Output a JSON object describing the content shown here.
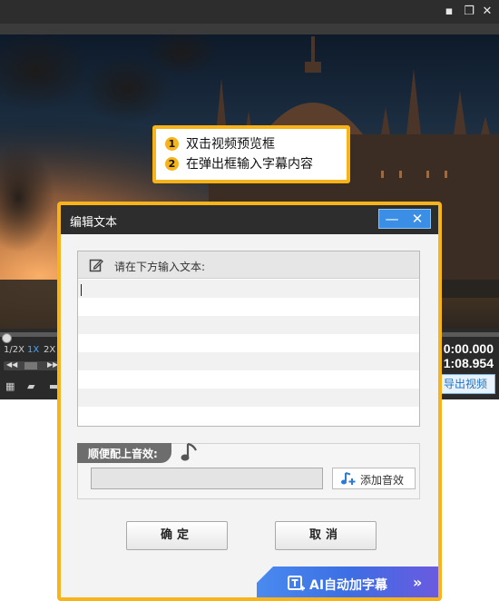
{
  "app": {
    "window_buttons": [
      "▪",
      "❐",
      "✕"
    ],
    "speeds": [
      "1/2X",
      "1X",
      "2X"
    ],
    "active_speed": "1X",
    "time_current": "0:00.000",
    "time_total": "1:08.954",
    "export_button": "导出视频",
    "export_visible": "导出视频"
  },
  "callout": {
    "steps": [
      {
        "num": "1",
        "text": "双击视频预览框"
      },
      {
        "num": "2",
        "text": "在弹出框输入字幕内容"
      }
    ]
  },
  "dialog": {
    "title": "编辑文本",
    "minimize_symbol": "—",
    "close_symbol": "✕",
    "editor_label": "请在下方输入文本:",
    "sound_label": "顺便配上音效:",
    "add_sound_button": "添加音效",
    "ok_button": "确定",
    "cancel_button": "取消",
    "ai_banner": "AI自动加字幕",
    "ai_banner_chevron": "»"
  },
  "colors": {
    "accent_orange": "#f7b41a",
    "title_bar": "#2d2d2d",
    "blue_button": "#3a8ee6",
    "ai_banner": "#4a8af0"
  }
}
